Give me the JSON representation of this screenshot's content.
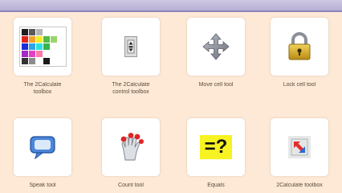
{
  "tiles": [
    {
      "label": "The 2Calculate\ntoolbox"
    },
    {
      "label": "The 2Calculate\ncontrol toolbox"
    },
    {
      "label": "Move cell tool"
    },
    {
      "label": "Lock cell tool"
    },
    {
      "label": "Speak tool"
    },
    {
      "label": "Count tool"
    },
    {
      "label": "Equals"
    },
    {
      "label": "2Calculate toolbox"
    }
  ],
  "palette_colors": [
    "#1e1e1e",
    "#5a5a5a",
    "#b4b4b4",
    "#ffffff",
    "#ffffff",
    "#ffffff",
    "#e5231b",
    "#f2a12d",
    "#f6ec23",
    "#53b947",
    "#9ad56b",
    "#ffffff",
    "#1b2fd6",
    "#2fa4e7",
    "#2ee0df",
    "#38b44a",
    "#ffffff",
    "#ffffff",
    "#a628c5",
    "#e440c6",
    "#ff7aa8",
    "#ffffff",
    "#ffffff",
    "#ffffff",
    "#333333",
    "#8c8c8c",
    "#ffffff",
    "#1b1b1b",
    "#ffffff",
    "#ffffff"
  ],
  "equals_symbol": "=?"
}
